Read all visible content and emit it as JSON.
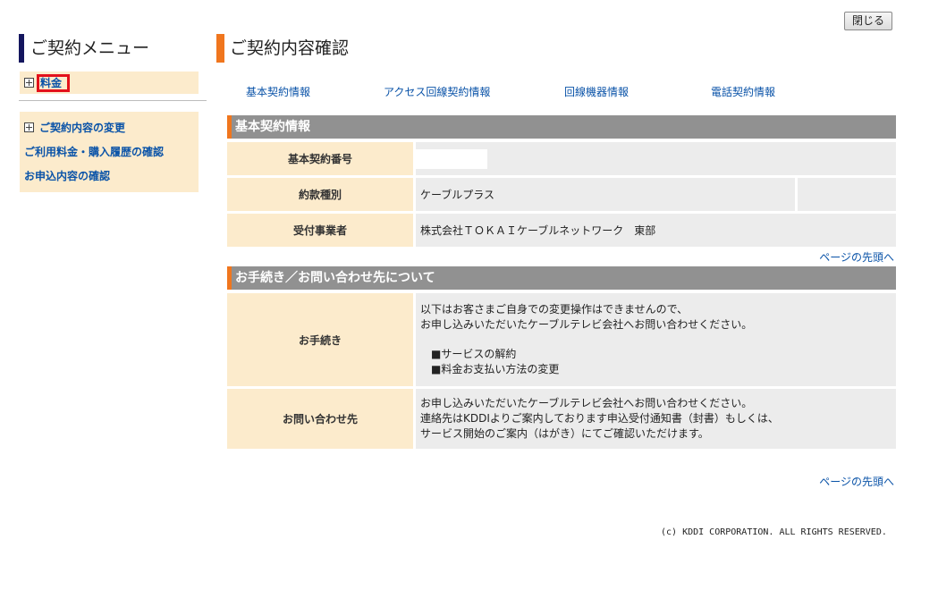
{
  "close_button": "閉じる",
  "sidebar": {
    "title": "ご契約メニュー",
    "fee_item": "料金",
    "items": [
      "ご契約内容の変更",
      "ご利用料金・購入履歴の確認",
      "お申込内容の確認"
    ]
  },
  "main": {
    "title": "ご契約内容確認",
    "tabs": [
      "基本契約情報",
      "アクセス回線契約情報",
      "回線機器情報",
      "電話契約情報"
    ],
    "section1": {
      "header": "基本契約情報",
      "rows": [
        {
          "label": "基本契約番号",
          "value": ""
        },
        {
          "label": "約款種別",
          "value": "ケーブルプラス",
          "extra": ""
        },
        {
          "label": "受付事業者",
          "value": "株式会社ＴＯＫＡＩケーブルネットワーク　東部"
        }
      ]
    },
    "to_top": "ページの先頭へ",
    "section2": {
      "header": "お手続き／お問い合わせ先について",
      "procedure_label": "お手続き",
      "procedure_lines": [
        "以下はお客さまご自身での変更操作はできませんので、",
        "お申し込みいただいたケーブルテレビ会社へお問い合わせください。",
        "■サービスの解約",
        "■料金お支払い方法の変更"
      ],
      "contact_label": "お問い合わせ先",
      "contact_lines": [
        "お申し込みいただいたケーブルテレビ会社へお問い合わせください。",
        "連絡先はKDDIよりご案内しております申込受付通知書（封書）もしくは、",
        "サービス開始のご案内（はがき）にてご確認いただけます。"
      ]
    },
    "to_top_2": "ページの先頭へ"
  },
  "footer": {
    "copyright": "(c) KDDI CORPORATION. ALL RIGHTS RESERVED."
  },
  "colors": {
    "sidebar_accent": "#14165e",
    "title_accent": "#f0761e",
    "label_bg": "#fcebcc",
    "value_bg": "#ececec",
    "section_header_bg": "#919191",
    "link": "#0a53a8",
    "highlight_border": "#e3111b"
  }
}
